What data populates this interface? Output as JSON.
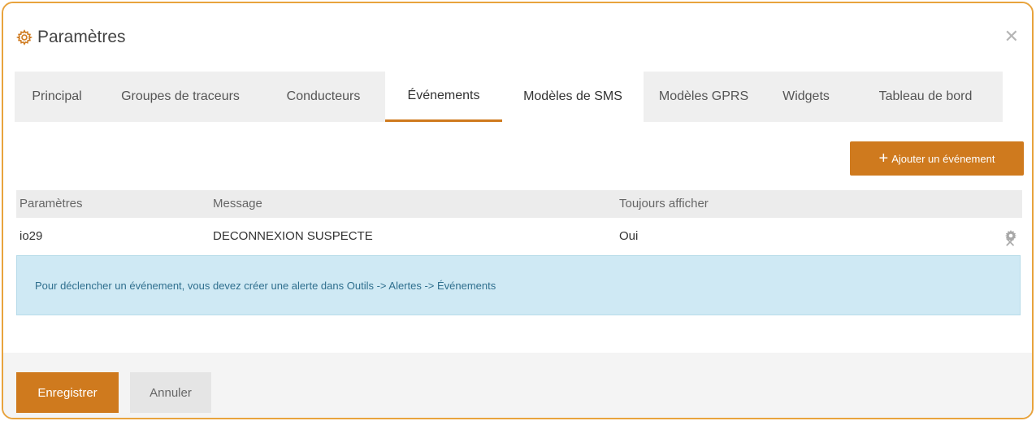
{
  "dialog": {
    "title": "Paramètres",
    "close_icon": "close-icon",
    "accent_color": "#cf7a1e",
    "border_color": "#e8a33d"
  },
  "tabs": [
    {
      "label": "Principal",
      "active": false
    },
    {
      "label": "Groupes de traceurs",
      "active": false
    },
    {
      "label": "Conducteurs",
      "active": false
    },
    {
      "label": "Événements",
      "active": true
    },
    {
      "label": "Modèles de SMS",
      "active": false
    },
    {
      "label": "Modèles GPRS",
      "active": false
    },
    {
      "label": "Widgets",
      "active": false
    },
    {
      "label": "Tableau de bord",
      "active": false
    }
  ],
  "toolbar": {
    "add_label": "Ajouter un événement",
    "add_icon": "plus-icon"
  },
  "table": {
    "headers": [
      "Paramètres",
      "Message",
      "Toujours afficher"
    ],
    "rows": [
      {
        "param": "io29",
        "message": "DECONNEXION SUSPECTE",
        "always_show": "Oui"
      }
    ]
  },
  "info": {
    "text": "Pour déclencher un événement, vous devez créer une alerte dans Outils -> Alertes -> Événements"
  },
  "footer": {
    "save_label": "Enregistrer",
    "cancel_label": "Annuler"
  }
}
